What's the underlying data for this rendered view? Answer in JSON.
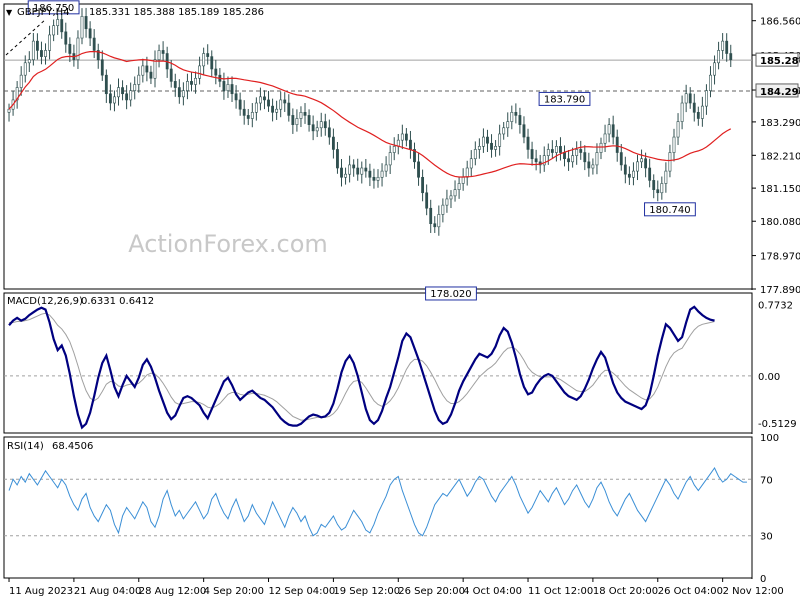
{
  "chart_data": [
    {
      "type": "line",
      "panel": "price",
      "header": {
        "symbol": "GBPJPY,H4",
        "values": "185.331 185.388 185.189 185.286"
      },
      "watermark": "ActionForex.com",
      "ylim": [
        177.89,
        187.1
      ],
      "y_ticks": [
        "186.560",
        "185.450",
        "184.320",
        "183.290",
        "182.210",
        "181.150",
        "180.080",
        "178.970",
        "177.890"
      ],
      "price_tags": [
        {
          "label": "185.286",
          "value": 185.286,
          "style": "current"
        },
        {
          "label": "184.290",
          "value": 184.29,
          "style": "level"
        }
      ],
      "annotations": [
        {
          "label": "186.750",
          "x": 11,
          "value": 186.75
        },
        {
          "label": "183.790",
          "x": 137,
          "value": 183.79
        },
        {
          "label": "178.020",
          "x": 109,
          "value": 178.02
        },
        {
          "label": "180.740",
          "x": 163,
          "value": 180.74
        }
      ],
      "x_tick_labels": [
        "11 Aug 2023",
        "21 Aug 04:00",
        "28 Aug 12:00",
        "4 Sep 20:00",
        "12 Sep 04:00",
        "19 Sep 12:00",
        "26 Sep 20:00",
        "4 Oct 04:00",
        "11 Oct 12:00",
        "18 Oct 20:00",
        "26 Oct 04:00",
        "2 Nov 12:00"
      ],
      "x_tick_index": [
        0,
        16,
        32,
        48,
        64,
        80,
        96,
        112,
        128,
        144,
        160,
        176
      ],
      "n_bars": 183,
      "closes": [
        183.7,
        184.0,
        184.4,
        184.8,
        185.2,
        185.3,
        185.9,
        185.6,
        185.4,
        185.6,
        186.1,
        186.4,
        186.6,
        186.2,
        185.8,
        185.5,
        185.3,
        186.0,
        186.7,
        186.3,
        186.0,
        185.6,
        185.3,
        184.8,
        184.2,
        183.9,
        184.1,
        184.4,
        184.2,
        184.0,
        184.3,
        184.5,
        184.8,
        185.1,
        184.9,
        184.7,
        185.3,
        185.6,
        185.5,
        185.0,
        184.6,
        184.4,
        184.1,
        184.3,
        184.6,
        184.5,
        184.7,
        185.1,
        185.5,
        185.4,
        185.0,
        184.8,
        184.6,
        184.3,
        184.5,
        184.2,
        184.0,
        183.7,
        183.5,
        183.4,
        183.6,
        183.9,
        184.1,
        184.0,
        183.8,
        183.6,
        183.7,
        184.0,
        183.9,
        183.5,
        183.2,
        183.4,
        183.6,
        183.5,
        183.2,
        183.0,
        183.1,
        183.3,
        183.1,
        182.8,
        182.4,
        181.8,
        181.5,
        181.6,
        181.9,
        181.8,
        181.6,
        181.8,
        181.7,
        181.5,
        181.4,
        181.5,
        181.7,
        181.9,
        182.3,
        182.5,
        182.7,
        182.9,
        182.7,
        182.4,
        182.0,
        181.5,
        181.0,
        180.5,
        180.0,
        179.9,
        180.3,
        180.6,
        180.8,
        180.9,
        181.1,
        181.3,
        181.5,
        181.8,
        182.1,
        182.4,
        182.5,
        182.8,
        182.6,
        182.4,
        182.5,
        182.9,
        183.1,
        183.3,
        183.6,
        183.5,
        183.2,
        182.8,
        182.4,
        182.1,
        182.0,
        181.9,
        182.2,
        182.4,
        182.3,
        182.5,
        182.3,
        182.1,
        182.0,
        182.2,
        182.4,
        182.3,
        182.0,
        181.8,
        181.9,
        182.3,
        182.6,
        182.9,
        183.2,
        182.8,
        182.3,
        181.9,
        181.6,
        181.5,
        181.7,
        182.0,
        182.1,
        181.8,
        181.4,
        181.1,
        181.0,
        181.3,
        181.7,
        182.3,
        182.8,
        183.3,
        183.9,
        184.2,
        183.9,
        183.6,
        183.4,
        183.8,
        184.3,
        184.8,
        185.2,
        185.6,
        185.9,
        185.5,
        185.3
      ],
      "ma_label": "moving average (red line)"
    },
    {
      "type": "line",
      "panel": "macd",
      "header": {
        "label": "MACD(12,26,9)",
        "values": "0.6331 0.6412"
      },
      "ylim": [
        -0.62,
        0.9
      ],
      "y_ticks": [
        "0.7732",
        "0.00",
        "-0.5129"
      ],
      "series": [
        {
          "name": "MACD",
          "values": [
            0.55,
            0.6,
            0.63,
            0.6,
            0.62,
            0.66,
            0.69,
            0.72,
            0.74,
            0.72,
            0.58,
            0.4,
            0.28,
            0.33,
            0.22,
            0.02,
            -0.22,
            -0.42,
            -0.56,
            -0.52,
            -0.4,
            -0.22,
            -0.02,
            0.14,
            0.22,
            0.06,
            -0.12,
            -0.22,
            -0.1,
            0.0,
            -0.06,
            -0.12,
            -0.02,
            0.12,
            0.18,
            0.1,
            -0.02,
            -0.16,
            -0.28,
            -0.4,
            -0.47,
            -0.43,
            -0.33,
            -0.24,
            -0.22,
            -0.24,
            -0.28,
            -0.32,
            -0.4,
            -0.46,
            -0.36,
            -0.26,
            -0.16,
            -0.06,
            -0.02,
            -0.1,
            -0.2,
            -0.26,
            -0.22,
            -0.18,
            -0.16,
            -0.2,
            -0.24,
            -0.26,
            -0.3,
            -0.34,
            -0.4,
            -0.46,
            -0.5,
            -0.53,
            -0.54,
            -0.54,
            -0.52,
            -0.48,
            -0.44,
            -0.42,
            -0.43,
            -0.45,
            -0.44,
            -0.4,
            -0.3,
            -0.14,
            0.04,
            0.16,
            0.22,
            0.14,
            0.0,
            -0.18,
            -0.36,
            -0.48,
            -0.52,
            -0.48,
            -0.38,
            -0.24,
            -0.12,
            0.04,
            0.2,
            0.38,
            0.46,
            0.42,
            0.3,
            0.18,
            0.04,
            -0.1,
            -0.24,
            -0.38,
            -0.48,
            -0.52,
            -0.5,
            -0.42,
            -0.3,
            -0.16,
            -0.06,
            0.02,
            0.1,
            0.18,
            0.24,
            0.22,
            0.2,
            0.24,
            0.32,
            0.44,
            0.52,
            0.48,
            0.36,
            0.2,
            0.02,
            -0.12,
            -0.2,
            -0.18,
            -0.1,
            -0.04,
            0.0,
            0.02,
            0.0,
            -0.06,
            -0.12,
            -0.18,
            -0.22,
            -0.24,
            -0.26,
            -0.22,
            -0.14,
            -0.04,
            0.08,
            0.18,
            0.26,
            0.2,
            0.06,
            -0.08,
            -0.18,
            -0.24,
            -0.28,
            -0.3,
            -0.32,
            -0.34,
            -0.36,
            -0.32,
            -0.2,
            0.0,
            0.22,
            0.4,
            0.56,
            0.52,
            0.45,
            0.38,
            0.42,
            0.58,
            0.72,
            0.75,
            0.7,
            0.66,
            0.63,
            0.61,
            0.6
          ]
        },
        {
          "name": "Signal",
          "values": [
            0.58,
            0.58,
            0.59,
            0.59,
            0.6,
            0.61,
            0.63,
            0.65,
            0.67,
            0.68,
            0.66,
            0.61,
            0.55,
            0.51,
            0.45,
            0.37,
            0.25,
            0.11,
            -0.04,
            -0.16,
            -0.24,
            -0.27,
            -0.24,
            -0.17,
            -0.09,
            -0.06,
            -0.07,
            -0.11,
            -0.12,
            -0.1,
            -0.09,
            -0.1,
            -0.08,
            -0.04,
            0.01,
            0.03,
            0.02,
            -0.02,
            -0.08,
            -0.15,
            -0.23,
            -0.29,
            -0.31,
            -0.3,
            -0.29,
            -0.28,
            -0.28,
            -0.29,
            -0.31,
            -0.34,
            -0.35,
            -0.33,
            -0.3,
            -0.25,
            -0.2,
            -0.18,
            -0.18,
            -0.2,
            -0.21,
            -0.2,
            -0.19,
            -0.19,
            -0.2,
            -0.21,
            -0.23,
            -0.25,
            -0.28,
            -0.32,
            -0.36,
            -0.4,
            -0.44,
            -0.46,
            -0.48,
            -0.48,
            -0.47,
            -0.46,
            -0.45,
            -0.45,
            -0.45,
            -0.44,
            -0.41,
            -0.36,
            -0.28,
            -0.19,
            -0.11,
            -0.06,
            -0.05,
            -0.07,
            -0.13,
            -0.2,
            -0.27,
            -0.31,
            -0.33,
            -0.31,
            -0.27,
            -0.21,
            -0.13,
            -0.03,
            0.07,
            0.14,
            0.18,
            0.18,
            0.16,
            0.11,
            0.04,
            -0.04,
            -0.13,
            -0.21,
            -0.27,
            -0.3,
            -0.3,
            -0.28,
            -0.24,
            -0.19,
            -0.13,
            -0.07,
            -0.01,
            0.03,
            0.07,
            0.1,
            0.14,
            0.2,
            0.26,
            0.3,
            0.31,
            0.29,
            0.24,
            0.17,
            0.09,
            0.04,
            0.01,
            -0.01,
            -0.01,
            -0.01,
            -0.01,
            -0.02,
            -0.04,
            -0.07,
            -0.1,
            -0.13,
            -0.16,
            -0.17,
            -0.17,
            -0.14,
            -0.1,
            -0.04,
            0.02,
            0.06,
            0.06,
            0.03,
            -0.01,
            -0.06,
            -0.11,
            -0.15,
            -0.18,
            -0.21,
            -0.24,
            -0.26,
            -0.25,
            -0.2,
            -0.12,
            -0.01,
            0.1,
            0.19,
            0.25,
            0.28,
            0.3,
            0.37,
            0.44,
            0.5,
            0.54,
            0.56,
            0.57,
            0.58,
            0.59
          ]
        }
      ]
    },
    {
      "type": "line",
      "panel": "rsi",
      "header": {
        "label": "RSI(14)",
        "values": "68.4506"
      },
      "ylim": [
        0,
        100
      ],
      "y_ticks": [
        "100",
        "70",
        "30",
        "0"
      ],
      "levels": [
        70,
        30
      ],
      "series": [
        {
          "name": "RSI",
          "values": [
            62,
            70,
            66,
            72,
            68,
            74,
            70,
            66,
            71,
            76,
            72,
            68,
            64,
            70,
            66,
            58,
            52,
            48,
            56,
            60,
            50,
            44,
            40,
            46,
            52,
            48,
            38,
            32,
            44,
            50,
            46,
            42,
            48,
            54,
            50,
            40,
            36,
            44,
            56,
            62,
            52,
            44,
            48,
            42,
            46,
            50,
            54,
            48,
            42,
            46,
            56,
            60,
            52,
            46,
            42,
            50,
            56,
            48,
            40,
            44,
            52,
            46,
            42,
            38,
            46,
            54,
            48,
            42,
            36,
            44,
            50,
            46,
            40,
            44,
            36,
            30,
            32,
            38,
            36,
            40,
            44,
            38,
            34,
            36,
            42,
            48,
            44,
            40,
            34,
            32,
            38,
            46,
            52,
            58,
            66,
            70,
            72,
            62,
            54,
            46,
            38,
            32,
            30,
            36,
            44,
            52,
            56,
            60,
            58,
            62,
            66,
            70,
            64,
            58,
            62,
            68,
            72,
            70,
            64,
            58,
            54,
            60,
            64,
            68,
            72,
            66,
            58,
            52,
            46,
            50,
            56,
            62,
            58,
            54,
            60,
            64,
            58,
            52,
            56,
            62,
            66,
            60,
            54,
            50,
            56,
            64,
            68,
            62,
            54,
            48,
            44,
            50,
            56,
            60,
            54,
            48,
            44,
            40,
            46,
            52,
            58,
            64,
            70,
            66,
            60,
            56,
            62,
            68,
            72,
            66,
            62,
            66,
            70,
            74,
            78,
            72,
            68,
            70,
            74,
            72,
            70,
            68,
            68
          ]
        }
      ]
    }
  ]
}
